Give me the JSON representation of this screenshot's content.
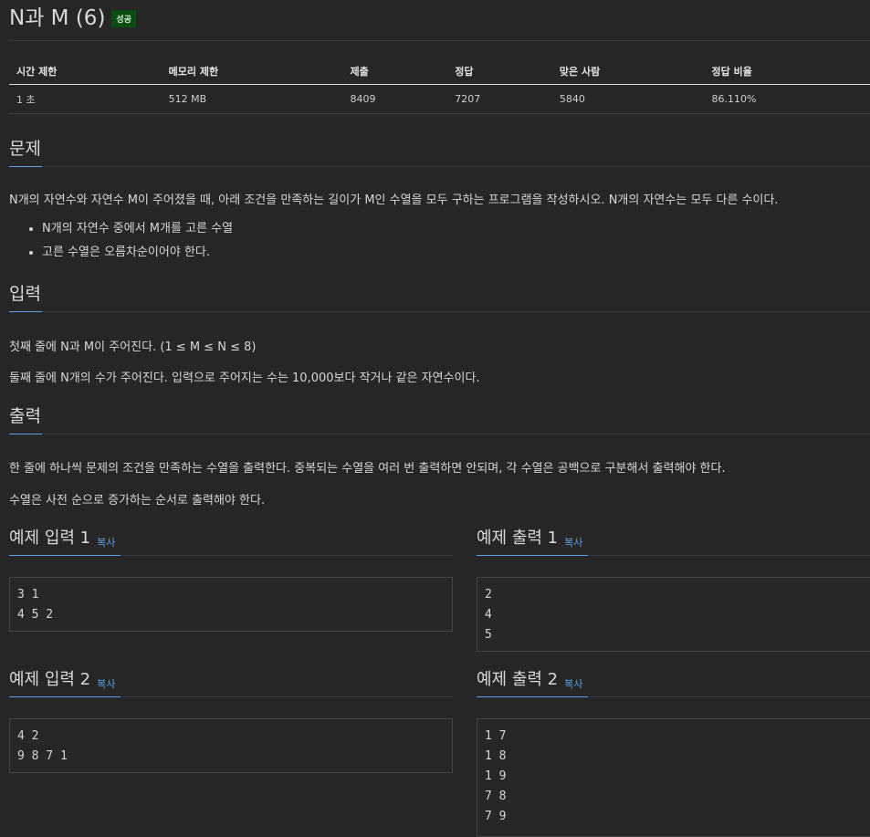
{
  "problem": {
    "title": "N과 M (6)",
    "badge": "성공",
    "badge_color": "#0a4d12"
  },
  "stats": {
    "headers": [
      "시간 제한",
      "메모리 제한",
      "제출",
      "정답",
      "맞은 사람",
      "정답 비율"
    ],
    "values": [
      "1 초",
      "512 MB",
      "8409",
      "7207",
      "5840",
      "86.110%"
    ]
  },
  "description": {
    "heading": "문제",
    "text": "N개의 자연수와 자연수 M이 주어졌을 때, 아래 조건을 만족하는 길이가 M인 수열을 모두 구하는 프로그램을 작성하시오. N개의 자연수는 모두 다른 수이다.",
    "conditions": [
      "N개의 자연수 중에서 M개를 고른 수열",
      "고른 수열은 오름차순이어야 한다."
    ]
  },
  "input": {
    "heading": "입력",
    "lines": [
      "첫째 줄에 N과 M이 주어진다. (1 ≤ M ≤ N ≤ 8)",
      "둘째 줄에 N개의 수가 주어진다. 입력으로 주어지는 수는 10,000보다 작거나 같은 자연수이다."
    ]
  },
  "output": {
    "heading": "출력",
    "lines": [
      "한 줄에 하나씩 문제의 조건을 만족하는 수열을 출력한다. 중복되는 수열을 여러 번 출력하면 안되며, 각 수열은 공백으로 구분해서 출력해야 한다.",
      "수열은 사전 순으로 증가하는 순서로 출력해야 한다."
    ]
  },
  "samples": {
    "copy_label": "복사",
    "in1_title": "예제 입력 1",
    "out1_title": "예제 출력 1",
    "in2_title": "예제 입력 2",
    "out2_title": "예제 출력 2",
    "in1": "3 1\n4 5 2",
    "out1": "2\n4\n5",
    "in2": "4 2\n9 8 7 1",
    "out2": "1 7\n1 8\n1 9\n7 8\n7 9"
  },
  "colors": {
    "background": "#262626",
    "accent": "#5da2e8",
    "text": "#d6d6d6"
  }
}
